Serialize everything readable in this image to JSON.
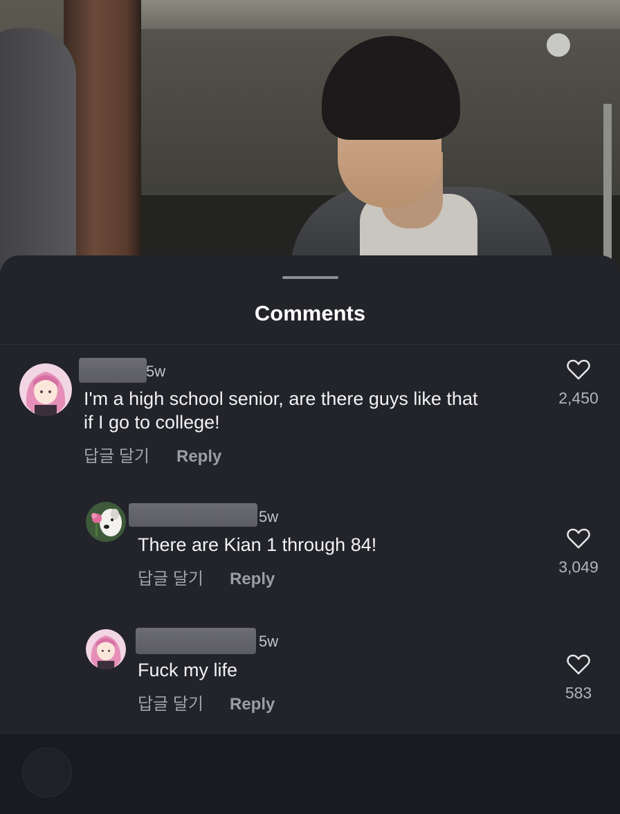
{
  "sheet": {
    "title": "Comments"
  },
  "comments": [
    {
      "time": "5w",
      "text": "I'm a high school senior, are there guys like that\nif I go to college!",
      "reply_kr": "답글 달기",
      "reply_en": "Reply",
      "likes": "2,450",
      "avatar_icon": "pink-hair-girl-avatar"
    },
    {
      "time": "5w",
      "text": "There are Kian 1 through 84!",
      "reply_kr": "답글 달기",
      "reply_en": "Reply",
      "likes": "3,049",
      "avatar_icon": "dog-with-flower-avatar"
    },
    {
      "time": "5w",
      "text": "Fuck my life",
      "reply_kr": "답글 달기",
      "reply_en": "Reply",
      "likes": "583",
      "avatar_icon": "pink-hair-girl-avatar"
    }
  ],
  "colors": {
    "sheet_background": "#22242a",
    "text_primary": "#f2f2f4",
    "text_secondary": "#a2a4a9"
  }
}
